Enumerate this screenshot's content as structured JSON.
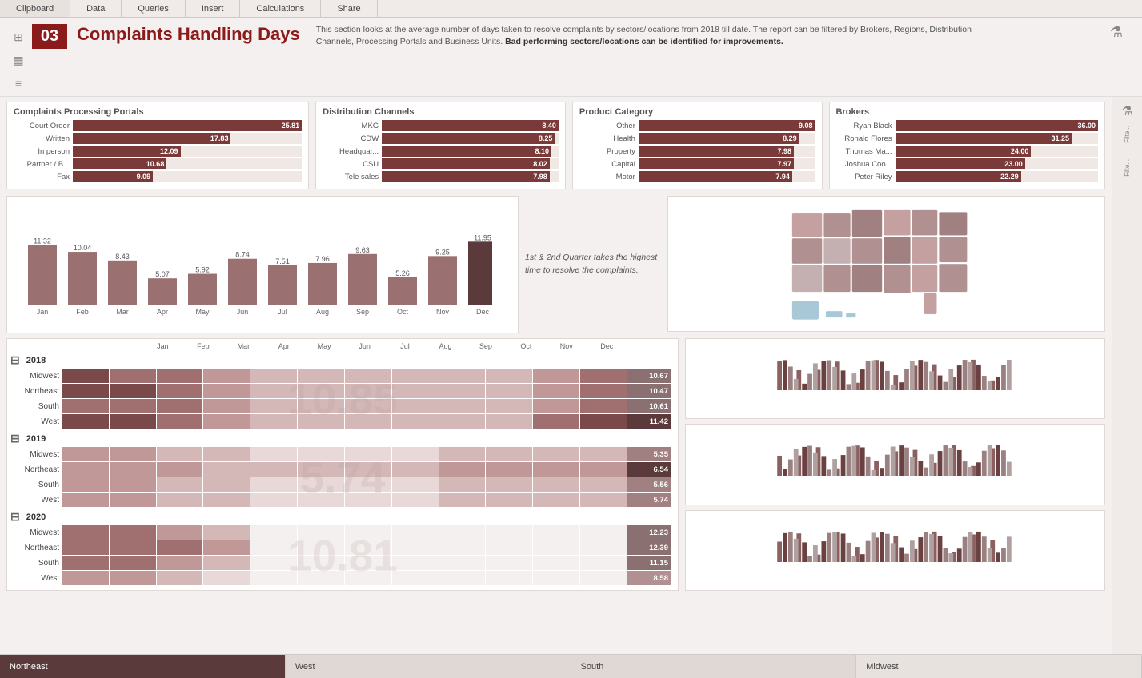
{
  "menuBar": {
    "items": [
      "Clipboard",
      "Data",
      "Queries",
      "Insert",
      "Calculations",
      "Share"
    ]
  },
  "header": {
    "pageNum": "03",
    "title": "Complaints Handling Days",
    "description": "This section looks at the average number of days taken to resolve complaints by sectors/locations from 2018 till date. The report can be filtered by Brokers, Regions, Distribution Channels, Processing Portals and Business Units.",
    "descriptionBold": "Bad performing sectors/locations can be identified for improvements."
  },
  "portals": {
    "title": "Complaints Processing Portals",
    "bars": [
      {
        "label": "Court Order",
        "value": 25.81,
        "pct": 100
      },
      {
        "label": "Written",
        "value": 17.83,
        "pct": 69
      },
      {
        "label": "In person",
        "value": 12.09,
        "pct": 47
      },
      {
        "label": "Partner / B...",
        "value": 10.68,
        "pct": 41
      },
      {
        "label": "Fax",
        "value": 9.09,
        "pct": 35
      }
    ]
  },
  "channels": {
    "title": "Distribution Channels",
    "bars": [
      {
        "label": "MKG",
        "value": 8.4,
        "pct": 100
      },
      {
        "label": "CDW",
        "value": 8.25,
        "pct": 98
      },
      {
        "label": "Headquar...",
        "value": 8.1,
        "pct": 96
      },
      {
        "label": "CSU",
        "value": 8.02,
        "pct": 95
      },
      {
        "label": "Tele sales",
        "value": 7.98,
        "pct": 95
      }
    ]
  },
  "productCategory": {
    "title": "Product Category",
    "bars": [
      {
        "label": "Other",
        "value": 9.08,
        "pct": 100
      },
      {
        "label": "Health",
        "value": 8.29,
        "pct": 91
      },
      {
        "label": "Property",
        "value": 7.98,
        "pct": 88
      },
      {
        "label": "Capital",
        "value": 7.97,
        "pct": 88
      },
      {
        "label": "Motor",
        "value": 7.94,
        "pct": 87
      }
    ]
  },
  "brokers": {
    "title": "Brokers",
    "bars": [
      {
        "label": "Ryan Black",
        "value": 36.0,
        "pct": 100
      },
      {
        "label": "Ronald Flores",
        "value": 31.25,
        "pct": 87
      },
      {
        "label": "Thomas Ma...",
        "value": 24.0,
        "pct": 67
      },
      {
        "label": "Joshua Coo...",
        "value": 23.0,
        "pct": 64
      },
      {
        "label": "Peter Riley",
        "value": 22.29,
        "pct": 62
      }
    ]
  },
  "monthlyChart": {
    "months": [
      "Jan",
      "Feb",
      "Mar",
      "Apr",
      "May",
      "Jun",
      "Jul",
      "Aug",
      "Sep",
      "Oct",
      "Nov",
      "Dec"
    ],
    "values": [
      11.32,
      10.04,
      8.43,
      5.07,
      5.92,
      8.74,
      7.51,
      7.96,
      9.63,
      5.26,
      9.25,
      11.95
    ],
    "note": "1st & 2nd Quarter takes the highest time to resolve the complaints."
  },
  "heatmap": {
    "years": [
      {
        "year": "2018",
        "regions": [
          {
            "name": "Midwest",
            "values": [
              5,
              4,
              4,
              3,
              2,
              2,
              2,
              2,
              2,
              2,
              3,
              4
            ],
            "total": 10.67,
            "totalColor": "#8a7070"
          },
          {
            "name": "Northeast",
            "values": [
              5,
              5,
              4,
              3,
              2,
              2,
              2,
              2,
              2,
              2,
              3,
              4
            ],
            "total": 10.47,
            "totalColor": "#8a7070"
          },
          {
            "name": "South",
            "values": [
              4,
              4,
              4,
              3,
              2,
              2,
              2,
              2,
              2,
              2,
              3,
              4
            ],
            "total": 10.61,
            "totalColor": "#8a7070"
          },
          {
            "name": "West",
            "values": [
              5,
              5,
              4,
              3,
              2,
              2,
              2,
              2,
              2,
              2,
              4,
              5
            ],
            "total": 11.42,
            "totalColor": "#5a3a3a"
          }
        ],
        "watermark": "10.85"
      },
      {
        "year": "2019",
        "regions": [
          {
            "name": "Midwest",
            "values": [
              3,
              3,
              2,
              2,
              1,
              1,
              1,
              1,
              2,
              2,
              2,
              2
            ],
            "total": 5.35,
            "totalColor": "#a08080"
          },
          {
            "name": "Northeast",
            "values": [
              3,
              3,
              3,
              2,
              2,
              2,
              2,
              2,
              3,
              3,
              3,
              3
            ],
            "total": 6.54,
            "totalColor": "#5a3a3a"
          },
          {
            "name": "South",
            "values": [
              3,
              3,
              2,
              2,
              1,
              1,
              1,
              1,
              2,
              2,
              2,
              2
            ],
            "total": 5.56,
            "totalColor": "#a08080"
          },
          {
            "name": "West",
            "values": [
              3,
              3,
              2,
              2,
              1,
              1,
              1,
              1,
              2,
              2,
              2,
              2
            ],
            "total": 5.74,
            "totalColor": "#a08080"
          }
        ],
        "watermark": "5.74"
      },
      {
        "year": "2020",
        "regions": [
          {
            "name": "Midwest",
            "values": [
              4,
              4,
              3,
              2,
              0,
              0,
              0,
              0,
              0,
              0,
              0,
              0
            ],
            "total": 12.23,
            "totalColor": "#8a7070"
          },
          {
            "name": "Northeast",
            "values": [
              4,
              4,
              4,
              3,
              0,
              0,
              0,
              0,
              0,
              0,
              0,
              0
            ],
            "total": 12.39,
            "totalColor": "#8a7070"
          },
          {
            "name": "South",
            "values": [
              4,
              4,
              3,
              2,
              0,
              0,
              0,
              0,
              0,
              0,
              0,
              0
            ],
            "total": 11.15,
            "totalColor": "#8a7070"
          },
          {
            "name": "West",
            "values": [
              3,
              3,
              2,
              1,
              0,
              0,
              0,
              0,
              0,
              0,
              0,
              0
            ],
            "total": 8.58,
            "totalColor": "#b09090"
          }
        ],
        "watermark": "10.81"
      }
    ]
  },
  "bottomBar": {
    "segments": [
      "Northeast",
      "West",
      "South",
      "Midwest"
    ]
  }
}
